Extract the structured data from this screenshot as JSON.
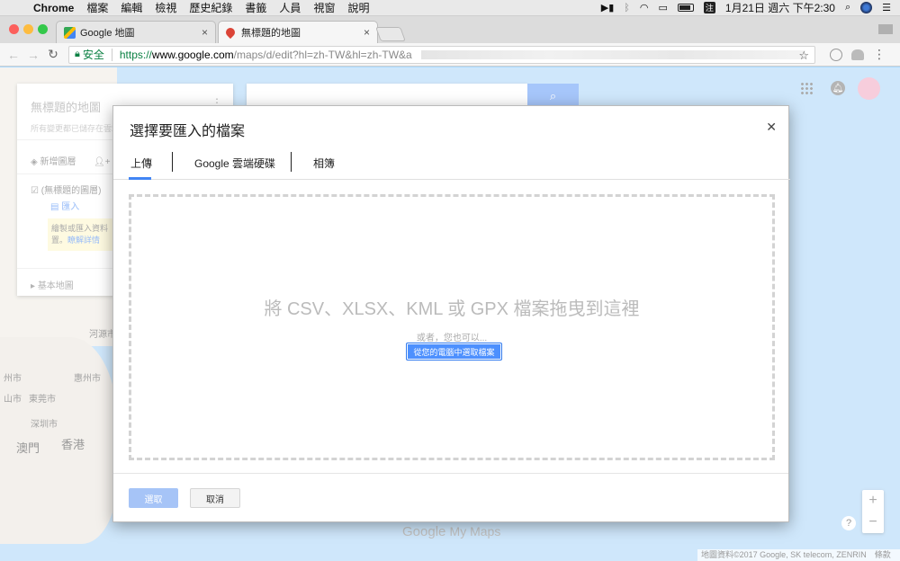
{
  "menubar": {
    "app": "Chrome",
    "items": [
      "檔案",
      "編輯",
      "檢視",
      "歷史紀錄",
      "書籤",
      "人員",
      "視窗",
      "說明"
    ],
    "ime": "注",
    "clock": "1月21日 週六 下午2:30"
  },
  "tabs": [
    {
      "title": "Google 地圖"
    },
    {
      "title": "無標題的地圖"
    }
  ],
  "toolbar": {
    "secure_label": "安全",
    "url_scheme": "https://",
    "url_host": "www.google.com",
    "url_path": "/maps/d/edit?hl=zh-TW&hl=zh-TW&a"
  },
  "sidepanel": {
    "title": "無標題的地圖",
    "subtitle": "所有變更都已儲存在雲端",
    "add_layer": "新增圖層",
    "share": "分",
    "layer_name": "(無標題的圖層)",
    "import": "匯入",
    "note_line1": "繪製或匯入資料",
    "note_line2_prefix": "置。",
    "note_link": "瞭解詳情",
    "base_map": "基本地圖"
  },
  "map": {
    "labels": [
      "河源市",
      "惠州市",
      "州市",
      "東莞市",
      "山市",
      "深圳市",
      "香港",
      "澳門"
    ],
    "logo_google": "Google",
    "logo_mymaps": "My Maps",
    "attribution": "地圖資料©2017 Google, SK telecom, ZENRIN　條款"
  },
  "dialog": {
    "title": "選擇要匯入的檔案",
    "tabs": [
      "上傳",
      "Google 雲端硬碟",
      "相簿"
    ],
    "drop_text": "將 CSV、XLSX、KML 或 GPX 檔案拖曳到這裡",
    "or_text": "或者，您也可以...",
    "pick_button": "從您的電腦中選取檔案",
    "select_button": "選取",
    "cancel_button": "取消"
  },
  "colors": {
    "accent_blue": "#4285f4",
    "pick_button": "#4d90fe",
    "select_disabled": "#a6c4f7"
  }
}
